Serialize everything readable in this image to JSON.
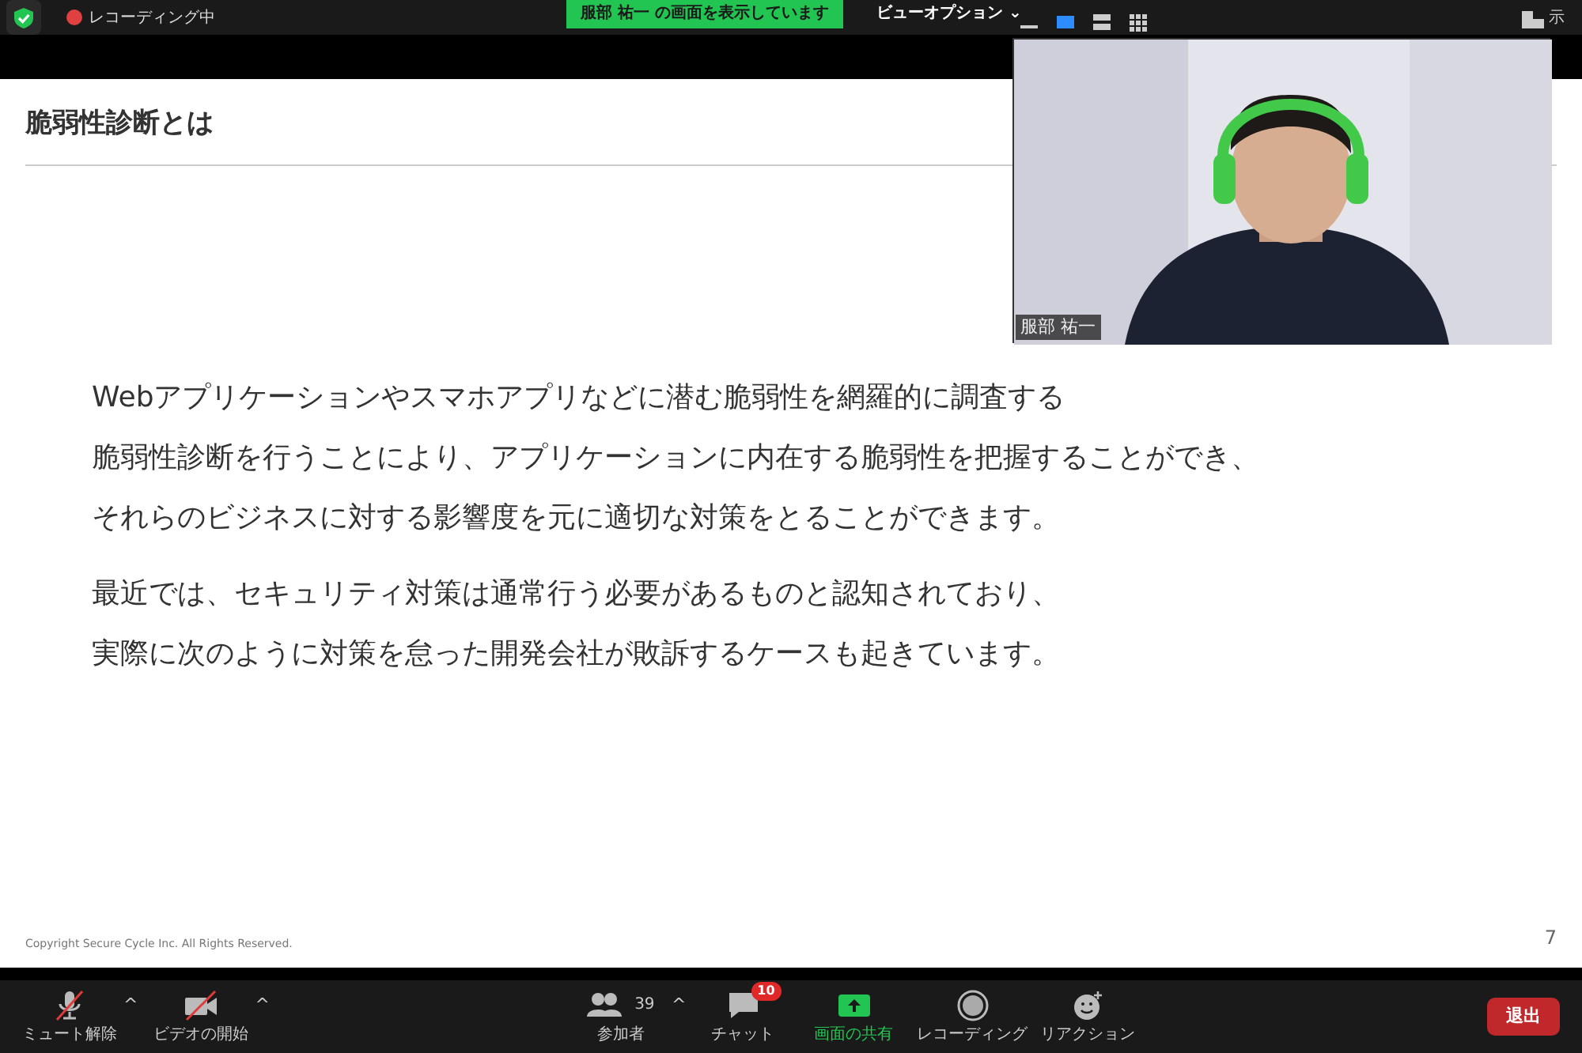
{
  "top_bar": {
    "recording_label": "レコーディング中",
    "sharing_banner": "服部 祐一 の画面を表示しています",
    "view_options": "ビューオプション",
    "view_options_caret": "⌄",
    "gallery_label": "示"
  },
  "layout_modes": [
    {
      "kind": "minimize",
      "selected": false
    },
    {
      "kind": "speaker",
      "selected": true
    },
    {
      "kind": "side",
      "selected": false
    },
    {
      "kind": "grid",
      "selected": false
    }
  ],
  "slide": {
    "title": "脆弱性診断とは",
    "paragraphs": [
      [
        "Webアプリケーションやスマホアプリなどに潜む脆弱性を網羅的に調査する",
        "脆弱性診断を行うことにより、アプリケーションに内在する脆弱性を把握することができ、",
        "それらのビジネスに対する影響度を元に適切な対策をとることができます。"
      ],
      [
        "最近では、セキュリティ対策は通常行う必要があるものと認知されており、",
        "実際に次のように対策を怠った開発会社が敗訴するケースも起きています。"
      ]
    ],
    "footer": "Copyright Secure Cycle Inc. All Rights Reserved.",
    "page_number": "7"
  },
  "video": {
    "kind": "picture",
    "name_tag": "服部 祐一"
  },
  "toolbar": [
    {
      "kind": "mic",
      "label": "ミュート解除",
      "caret": "^",
      "active": false
    },
    {
      "kind": "video",
      "label": "ビデオの開始",
      "caret": "^",
      "active": false
    },
    {
      "kind": "participants",
      "label": "参加者",
      "count": "39",
      "caret": "^",
      "active": false
    },
    {
      "kind": "chat",
      "label": "チャット",
      "badge": "10",
      "active": false
    },
    {
      "kind": "share",
      "label": "画面の共有",
      "active": true
    },
    {
      "kind": "record",
      "label": "レコーディング",
      "active": false
    },
    {
      "kind": "reaction",
      "label": "リアクション",
      "active": false
    }
  ],
  "leave_button": "退出"
}
